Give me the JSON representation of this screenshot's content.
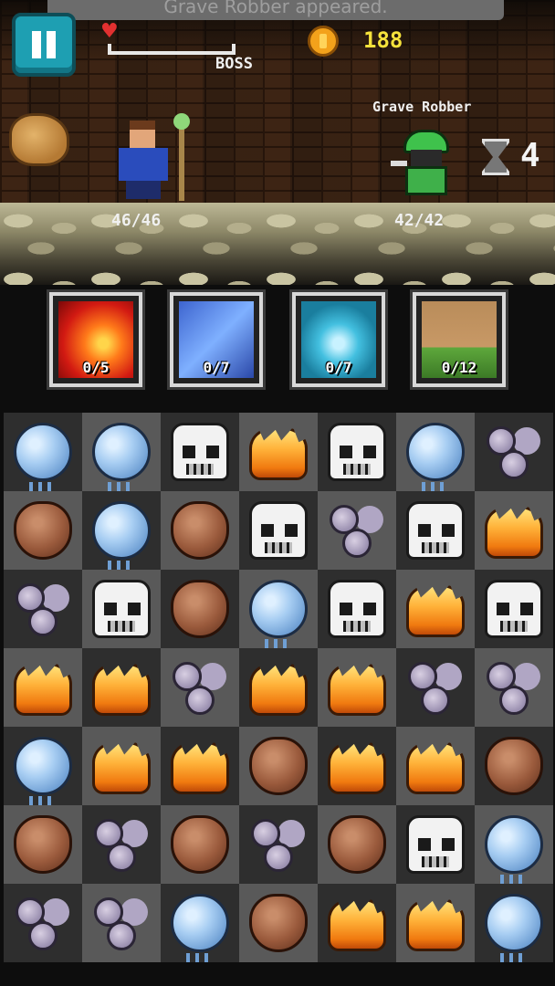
{
  "notice": "Grave Robber appeared.",
  "hud": {
    "progress_label": "BOSS",
    "coins": "188",
    "turns": "4"
  },
  "hero": {
    "hp": "46/46"
  },
  "enemy": {
    "name": "Grave Robber",
    "hp": "42/42"
  },
  "skills": [
    {
      "element": "fire",
      "count": "0/5"
    },
    {
      "element": "ice",
      "count": "0/7"
    },
    {
      "element": "wind",
      "count": "0/7"
    },
    {
      "element": "earth",
      "count": "0/12"
    }
  ],
  "board": [
    [
      "water",
      "water",
      "skull",
      "fire",
      "skull",
      "water",
      "wind"
    ],
    [
      "earth",
      "water",
      "earth",
      "skull",
      "wind",
      "skull",
      "fire"
    ],
    [
      "wind",
      "skull",
      "earth",
      "water",
      "skull",
      "fire",
      "skull"
    ],
    [
      "fire",
      "fire",
      "wind",
      "fire",
      "fire",
      "wind",
      "wind"
    ],
    [
      "water",
      "fire",
      "fire",
      "earth",
      "fire",
      "fire",
      "earth"
    ],
    [
      "earth",
      "wind",
      "earth",
      "wind",
      "earth",
      "skull",
      "water"
    ],
    [
      "wind",
      "wind",
      "water",
      "earth",
      "fire",
      "fire",
      "water"
    ]
  ],
  "colors": {
    "coin_text": "#f5e23c",
    "pause_button": "#1e9fb2",
    "board_light": "#595959",
    "board_dark": "#2e2e2e"
  }
}
